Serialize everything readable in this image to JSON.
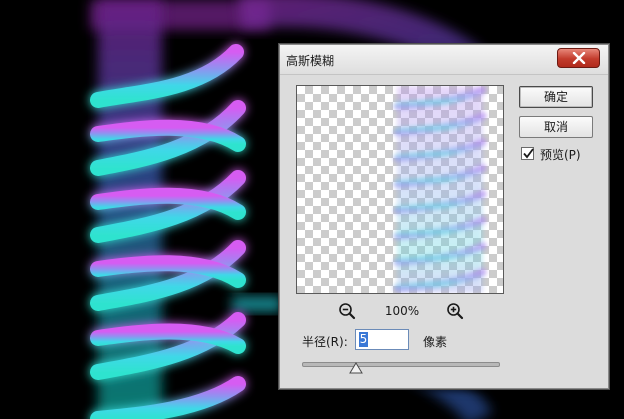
{
  "dialog": {
    "title": "高斯模糊",
    "close_icon": "close-icon",
    "ok_label": "确定",
    "cancel_label": "取消",
    "preview_checkbox": {
      "label": "预览(P)",
      "checked": true
    },
    "zoom": {
      "zoom_out_icon": "zoom-out-icon",
      "zoom_in_icon": "zoom-in-icon",
      "level": "100%"
    },
    "radius": {
      "label": "半径(R):",
      "value": "5",
      "unit": "像素"
    }
  },
  "colors": {
    "background": "#000000",
    "dialog_bg": "#dcdcdc",
    "close_button": "#c23b2c",
    "neon_top": "#c455e6",
    "neon_bottom": "#3fe0d9",
    "selection": "#3a78d6"
  }
}
